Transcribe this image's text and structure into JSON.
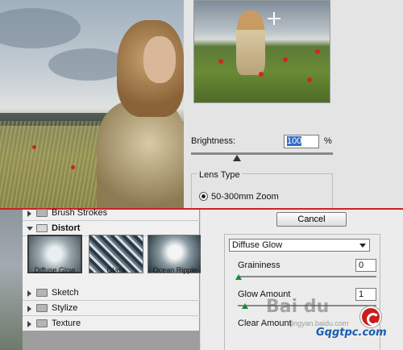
{
  "preview_panel": {
    "brightness_label": "Brightness:",
    "brightness_value": "100",
    "brightness_unit": "%",
    "brightness_slider_fraction": 0.3,
    "lens_type_title": "Lens Type",
    "lens_option": "50-300mm Zoom"
  },
  "filter_gallery": {
    "categories": [
      {
        "label": "Brush Strokes",
        "expanded": false
      },
      {
        "label": "Distort",
        "expanded": true
      },
      {
        "label": "Sketch",
        "expanded": false
      },
      {
        "label": "Stylize",
        "expanded": false
      },
      {
        "label": "Texture",
        "expanded": false
      }
    ],
    "distort_filters": [
      {
        "label": "Diffuse Glow",
        "selected": true
      },
      {
        "label": "Glass",
        "selected": false
      },
      {
        "label": "Ocean Ripple",
        "selected": false
      }
    ]
  },
  "settings": {
    "cancel_label": "Cancel",
    "selected_filter": "Diffuse Glow",
    "params": [
      {
        "label": "Graininess",
        "value": "0"
      },
      {
        "label": "Glow Amount",
        "value": "1"
      },
      {
        "label": "Clear Amount",
        "value": ""
      }
    ]
  },
  "watermark": {
    "text": "Bai du",
    "sub": "jingyan.baidu.com",
    "site": "Gqgtpc.com"
  }
}
